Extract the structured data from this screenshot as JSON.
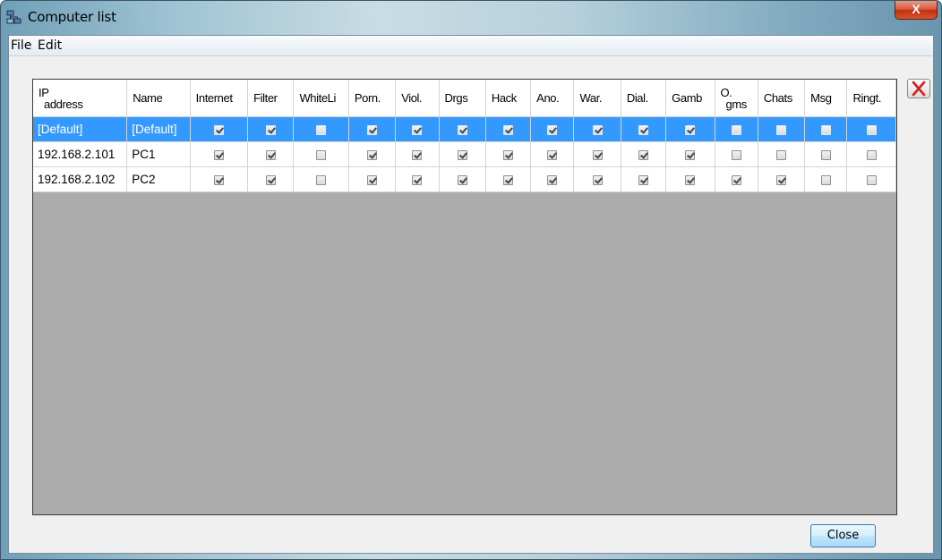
{
  "window": {
    "title": "Computer list",
    "close_glyph": "X",
    "icon": "network-computers-icon"
  },
  "menu": {
    "items": [
      "File",
      "Edit"
    ]
  },
  "table": {
    "headers": [
      [
        "IP",
        "address"
      ],
      [
        "Name"
      ],
      [
        "Internet"
      ],
      [
        "Filter"
      ],
      [
        "WhiteLi"
      ],
      [
        "Porn."
      ],
      [
        "Viol."
      ],
      [
        "Drgs"
      ],
      [
        "Hack"
      ],
      [
        "Ano."
      ],
      [
        "War."
      ],
      [
        "Dial."
      ],
      [
        "Gamb"
      ],
      [
        "O.",
        "gms"
      ],
      [
        "Chats"
      ],
      [
        "Msg"
      ],
      [
        "Ringt."
      ]
    ],
    "rows": [
      {
        "ip": "[Default]",
        "name": "[Default]",
        "selected": true,
        "flags": [
          true,
          true,
          false,
          true,
          true,
          true,
          true,
          true,
          true,
          true,
          true,
          false,
          false,
          false,
          false
        ]
      },
      {
        "ip": "192.168.2.101",
        "name": "PC1",
        "selected": false,
        "flags": [
          true,
          true,
          false,
          true,
          true,
          true,
          true,
          true,
          true,
          true,
          true,
          false,
          false,
          false,
          false
        ]
      },
      {
        "ip": "192.168.2.102",
        "name": "PC2",
        "selected": false,
        "flags": [
          true,
          true,
          false,
          true,
          true,
          true,
          true,
          true,
          true,
          true,
          true,
          true,
          true,
          false,
          false
        ]
      }
    ]
  },
  "delete_button": {
    "icon": "red-x-icon"
  },
  "close_button": {
    "label": "Close"
  },
  "colors": {
    "selection": "#3399ff",
    "grid_background": "#ababab",
    "delete_icon": "#d42020"
  }
}
